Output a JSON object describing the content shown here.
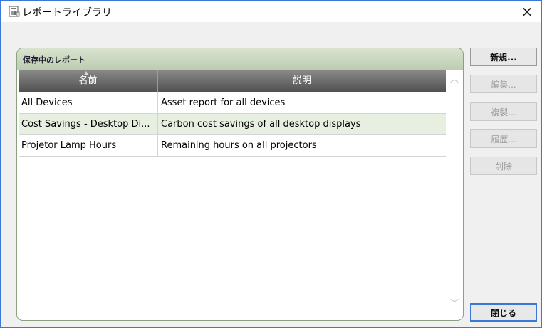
{
  "window": {
    "title": "レポートライブラリ",
    "icon": "report-library-icon",
    "close_glyph": "×"
  },
  "panel": {
    "title": "保存中のレポート"
  },
  "table": {
    "columns": [
      "名前",
      "説明"
    ],
    "rows": [
      {
        "name": "All Devices",
        "description": "Asset report for all devices"
      },
      {
        "name": "Cost Savings - Desktop Di...",
        "description": "Carbon cost savings of all desktop displays"
      },
      {
        "name": "Projetor Lamp Hours",
        "description": "Remaining hours on all projectors"
      }
    ]
  },
  "buttons": {
    "new": "新規...",
    "edit": "編集...",
    "duplicate": "複製...",
    "history": "履歴...",
    "delete": "削除",
    "close": "閉じる"
  },
  "colors": {
    "accent": "#3a78d6",
    "panel_header": "#c8d6bc",
    "alt_row": "#e7efe1",
    "grid_header": "#5a5a5a"
  }
}
